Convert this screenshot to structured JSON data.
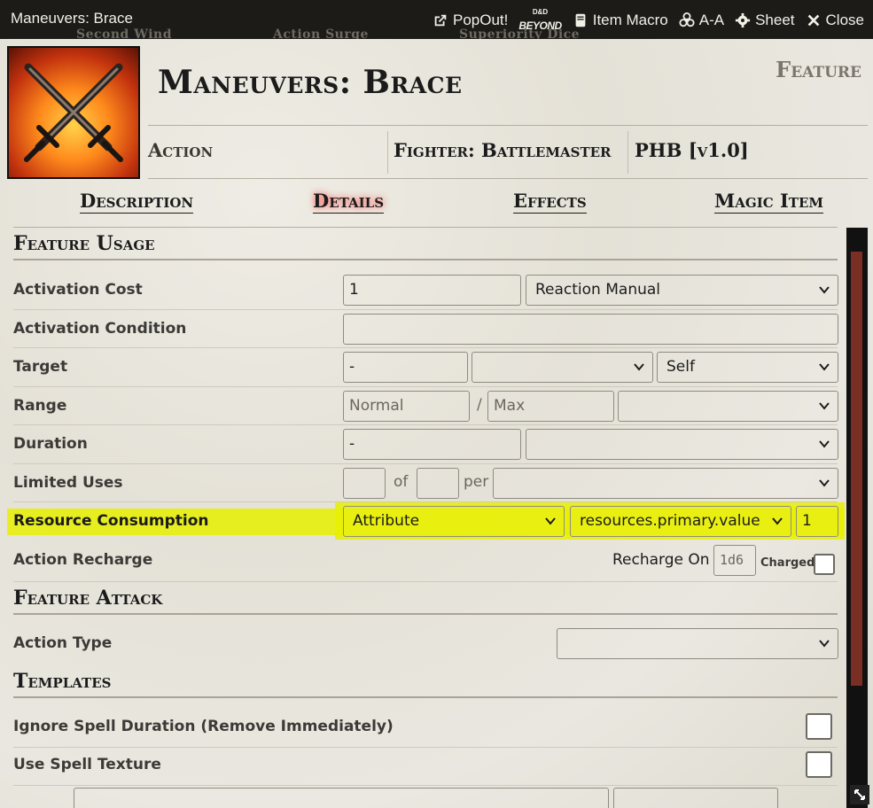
{
  "window": {
    "title": "Maneuvers: Brace",
    "ghost_texts": [
      "Second Wind",
      "Action Surge",
      "Superiority Dice"
    ],
    "actions": {
      "popout": "PopOut!",
      "ddb_small": "D&D",
      "ddb_big": "BEYOND",
      "item_macro": "Item Macro",
      "aa": "A-A",
      "sheet": "Sheet",
      "close": "Close"
    }
  },
  "header": {
    "name": "Maneuvers: Brace",
    "type": "Feature",
    "activation": "Action",
    "requirements": "Fighter: Battlemaster",
    "source": "PHB [v1.0]"
  },
  "tabs": [
    {
      "label": "Description"
    },
    {
      "label": "Details",
      "active": true
    },
    {
      "label": "Effects"
    },
    {
      "label": "Magic Item"
    }
  ],
  "feature_usage": {
    "title": "Feature Usage",
    "activation_cost": {
      "label": "Activation Cost",
      "value": "1",
      "type": "Reaction Manual"
    },
    "activation_condition": {
      "label": "Activation Condition",
      "value": ""
    },
    "target": {
      "label": "Target",
      "value": "-",
      "units": "",
      "type": "Self"
    },
    "range": {
      "label": "Range",
      "normal_placeholder": "Normal",
      "sep": "/",
      "max_placeholder": "Max",
      "units": ""
    },
    "duration": {
      "label": "Duration",
      "value": "-",
      "units": ""
    },
    "limited_uses": {
      "label": "Limited Uses",
      "value": "",
      "of": "of",
      "max": "",
      "per_label": "per",
      "per": ""
    },
    "resource_consumption": {
      "label": "Resource Consumption",
      "type": "Attribute",
      "target": "resources.primary.value",
      "amount": "1"
    },
    "action_recharge": {
      "label": "Action Recharge",
      "recharge_on_label": "Recharge On",
      "recharge_placeholder": "1d6",
      "charged_label": "Charged"
    }
  },
  "feature_attack": {
    "title": "Feature Attack",
    "action_type": {
      "label": "Action Type",
      "value": ""
    }
  },
  "templates": {
    "title": "Templates",
    "ignore_spell_duration": {
      "label": "Ignore Spell Duration (Remove Immediately)"
    },
    "use_spell_texture": {
      "label": "Use Spell Texture"
    }
  },
  "colors": {
    "highlight": "#e8f000",
    "scroll_thumb": "#7b2e24",
    "titlebar": "#1c1b18"
  }
}
